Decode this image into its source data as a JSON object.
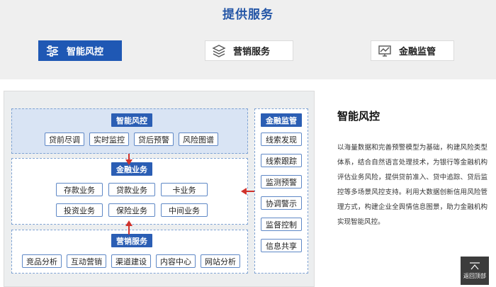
{
  "page": {
    "section_title": "提供服务"
  },
  "tabs": [
    {
      "label": "智能风控",
      "icon": "sliders-icon",
      "active": true
    },
    {
      "label": "营销服务",
      "icon": "layers-icon",
      "active": false
    },
    {
      "label": "金融监管",
      "icon": "monitor-chart-icon",
      "active": false
    }
  ],
  "diagram": {
    "risk": {
      "title": "智能风控",
      "items": [
        "贷前尽调",
        "实时监控",
        "贷后预警",
        "风险图谱"
      ]
    },
    "finance": {
      "title": "金融业务",
      "row1": [
        "存款业务",
        "贷款业务",
        "卡业务"
      ],
      "row2": [
        "投资业务",
        "保险业务",
        "中间业务"
      ]
    },
    "marketing": {
      "title": "营销服务",
      "items": [
        "竞品分析",
        "互动营销",
        "渠道建设",
        "内容中心",
        "网站分析"
      ]
    },
    "supervision": {
      "title": "金融监管",
      "items": [
        "线索发现",
        "线索跟踪",
        "监测预警",
        "协调警示",
        "监督控制",
        "信息共享"
      ]
    }
  },
  "description": {
    "title": "智能风控",
    "text": "以海量数据和完善预警模型为基础，构建风险类型体系，结合自然语言处理技术，为银行等金融机构评估业务风险，提供贷前准入、贷中追踪、贷后监控等多场景风控支持。利用大数据创新信用风险管理方式，构建企业全舆情信息图景，助力金融机构实现智能风控。"
  },
  "back_to_top": {
    "label": "返回顶部"
  },
  "colors": {
    "accent": "#1f58b4",
    "header_blue": "#2b5eb4",
    "arrow_red": "#d0322b",
    "title_blue": "#2355a6"
  }
}
